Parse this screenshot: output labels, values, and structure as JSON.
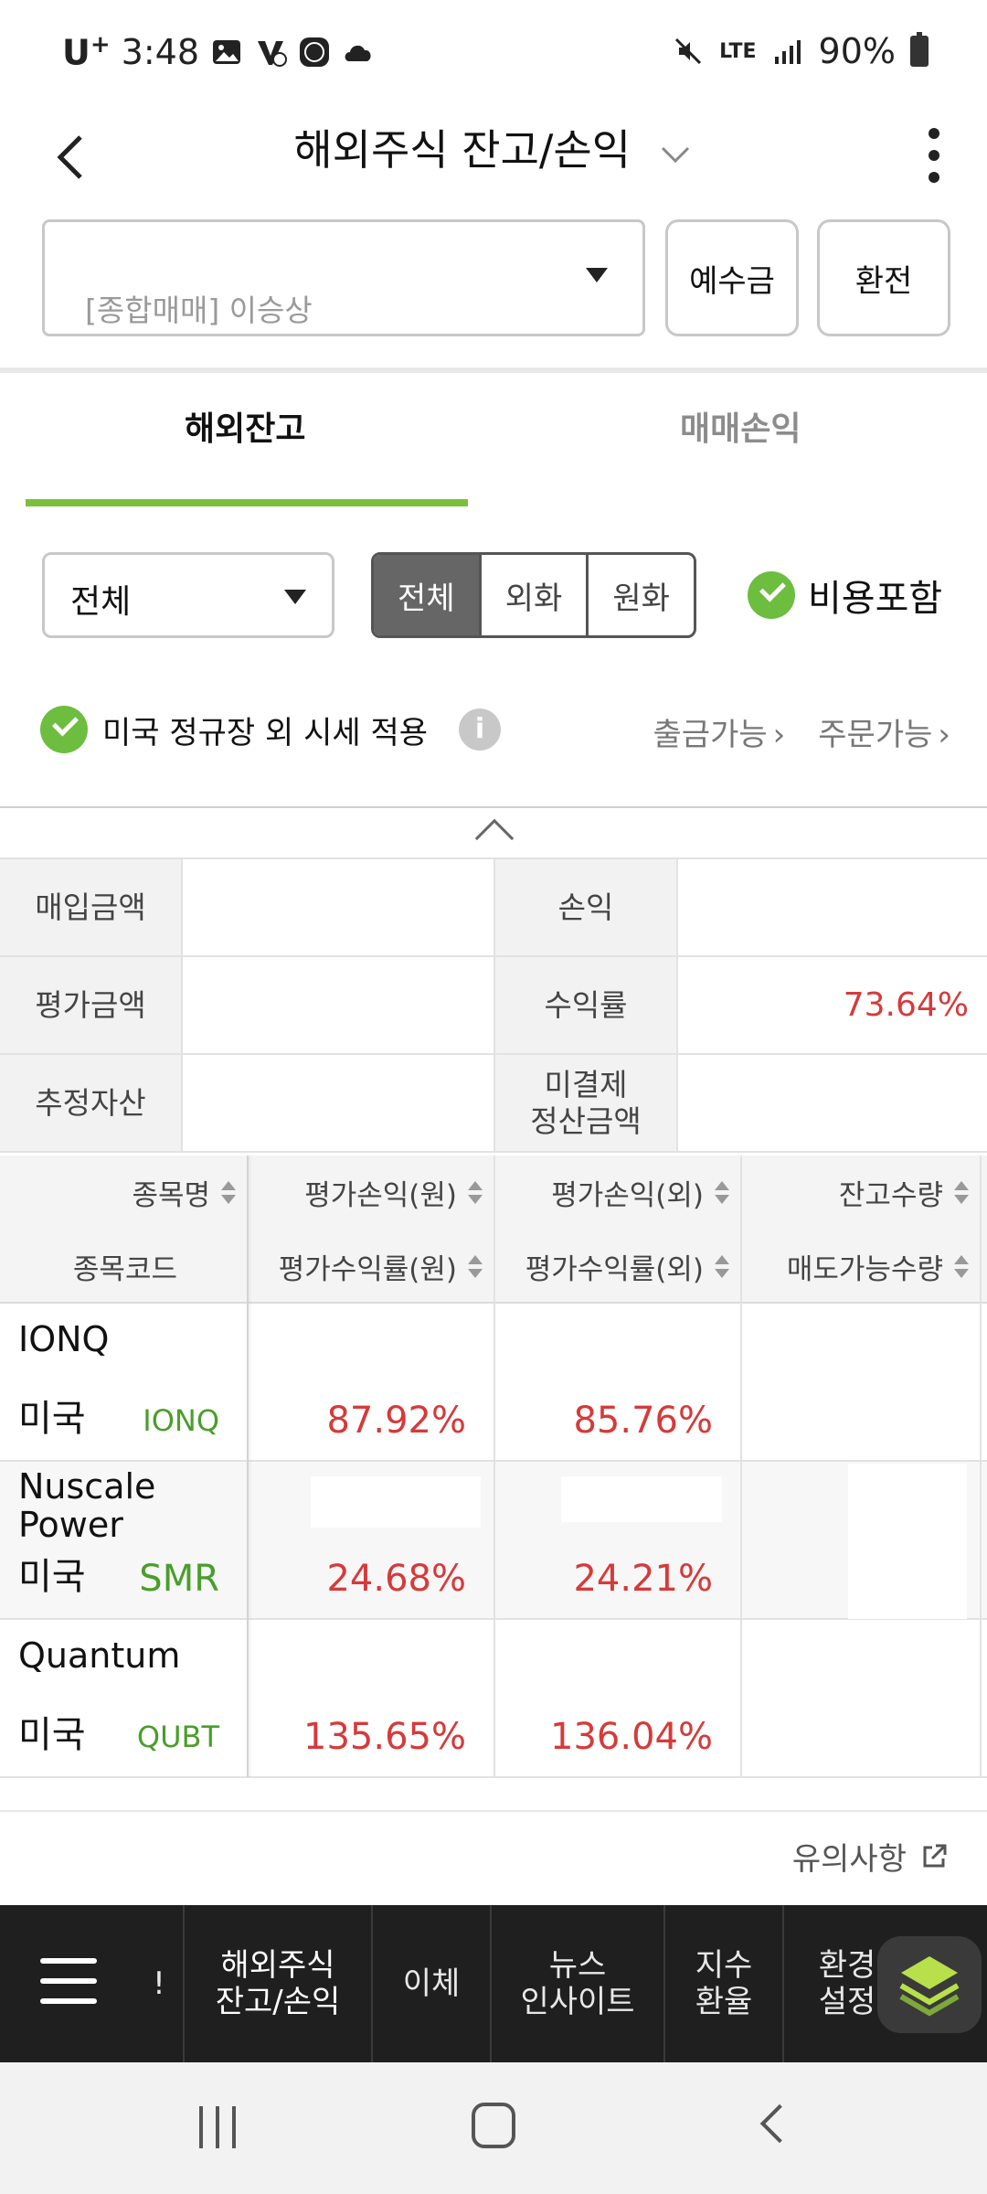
{
  "status_bar": {
    "carrier": "U",
    "carrier_sup": "+",
    "time": "3:48",
    "network": "LTE",
    "battery": "90%",
    "icons": [
      "gallery-icon",
      "app-icon",
      "app-icon",
      "cloud-icon",
      "mute-icon",
      "signal-icon",
      "battery-icon"
    ]
  },
  "header": {
    "title": "해외주식 잔고/손익"
  },
  "account": {
    "placeholder": "[종합매매] 이승상",
    "deposit_label": "예수금",
    "exchange_label": "환전"
  },
  "tabs": [
    {
      "label": "해외잔고",
      "active": true
    },
    {
      "label": "매매손익",
      "active": false
    }
  ],
  "filters": {
    "select_value": "전체",
    "segments": [
      {
        "label": "전체",
        "active": true
      },
      {
        "label": "외화",
        "active": false
      },
      {
        "label": "원화",
        "active": false
      }
    ],
    "cost_included_label": "비용포함",
    "cost_included_checked": true
  },
  "market_row": {
    "label": "미국 정규장 외 시세 적용",
    "checked": true,
    "link_withdraw": "출금가능",
    "link_order": "주문가능"
  },
  "summary": {
    "rows": [
      {
        "l1": "매입금액",
        "v1": "",
        "l2": "손익",
        "v2": ""
      },
      {
        "l1": "평가금액",
        "v1": "",
        "l2": "수익률",
        "v2": "73.64%"
      },
      {
        "l1": "추정자산",
        "v1": "",
        "l2a": "미결제",
        "l2b": "정산금액",
        "v2": ""
      }
    ]
  },
  "holdings": {
    "headers_top": [
      "종목명",
      "평가손익(원)",
      "평가손익(외)",
      "잔고수량"
    ],
    "headers_bottom": [
      "종목코드",
      "평가수익률(원)",
      "평가수익률(외)",
      "매도가능수량"
    ],
    "rows": [
      {
        "name": "IONQ",
        "name2": "",
        "country": "미국",
        "code": "IONQ",
        "pct_krw": "87.92%",
        "pct_fx": "85.76%"
      },
      {
        "name": "Nuscale",
        "name2": "Power",
        "country": "미국",
        "code": "SMR",
        "pct_krw": "24.68%",
        "pct_fx": "24.21%"
      },
      {
        "name": "Quantum",
        "name2": "",
        "country": "미국",
        "code": "QUBT",
        "pct_krw": "135.65%",
        "pct_fx": "136.04%"
      }
    ]
  },
  "notice_label": "유의사항",
  "app_nav": {
    "partial_label": "!",
    "items": [
      {
        "line1": "해외주식",
        "line2": "잔고/손익",
        "active": true
      },
      {
        "line1": "이체",
        "line2": "",
        "active": false
      },
      {
        "line1": "뉴스",
        "line2": "인사이트",
        "active": false
      },
      {
        "line1": "지수",
        "line2": "환율",
        "active": false
      },
      {
        "line1": "환경",
        "line2": "설정",
        "active": false
      }
    ]
  },
  "colors": {
    "accent_green": "#7cbf3e",
    "profit_red": "#d63a3a",
    "code_green": "#4a9e2a",
    "nav_dark": "#1f1f1f"
  }
}
